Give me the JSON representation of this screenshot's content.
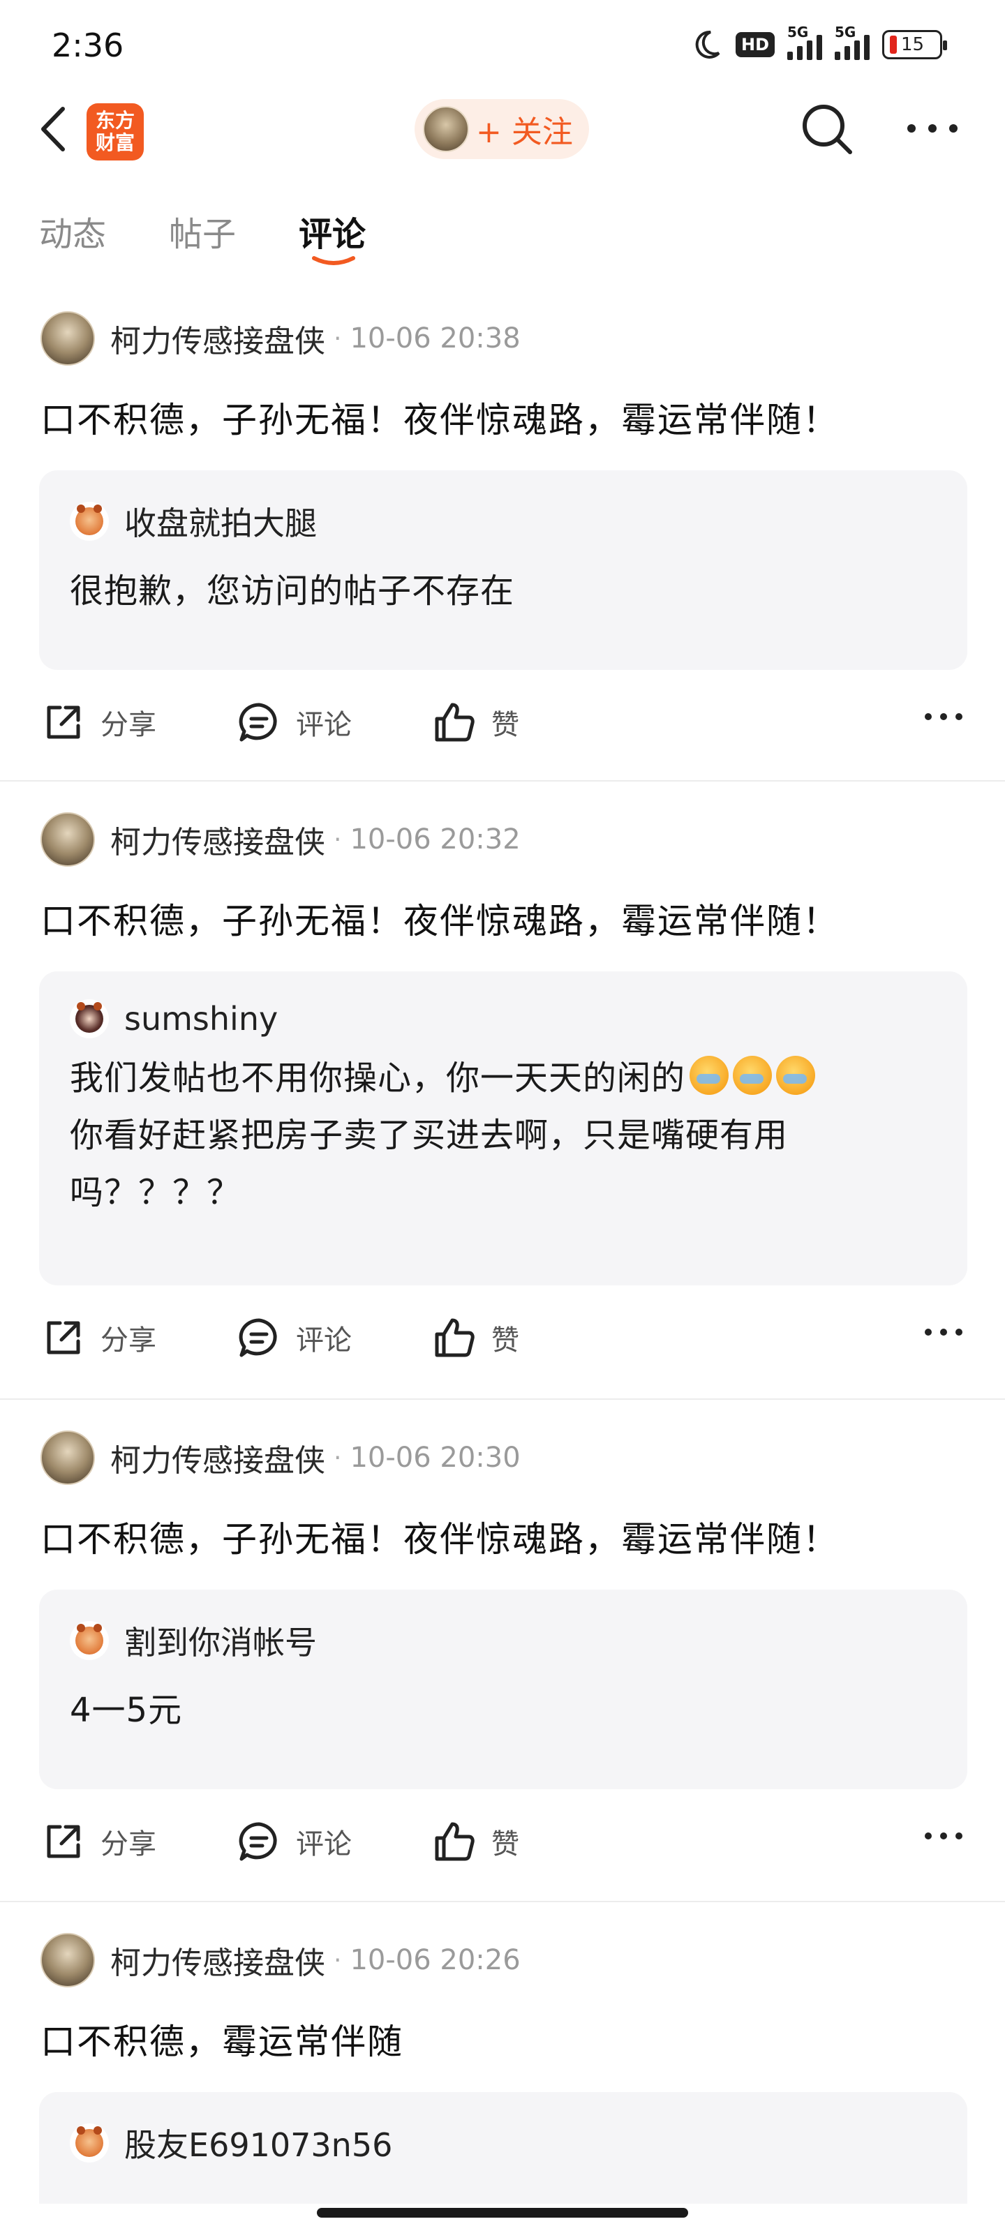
{
  "status_bar": {
    "time": "2:36",
    "hd": "HD",
    "net1": "5G",
    "net2": "5G",
    "battery": "15"
  },
  "nav": {
    "logo_line1": "东方",
    "logo_line2": "财富",
    "follow_label": "+ 关注"
  },
  "tabs": [
    {
      "label": "动态"
    },
    {
      "label": "帖子"
    },
    {
      "label": "评论"
    }
  ],
  "accent_color": "#f25a21",
  "actions": {
    "share": "分享",
    "comment": "评论",
    "like": "赞"
  },
  "posts": [
    {
      "author": "柯力传感接盘侠",
      "separator": "·",
      "time": "10-06 20:38",
      "text": "口不积德，子孙无福！夜伴惊魂路，霉运常伴随！",
      "quote_user": "收盘就拍大腿",
      "quote_line1": "很抱歉，您访问的帖子不存在"
    },
    {
      "author": "柯力传感接盘侠",
      "separator": "·",
      "time": "10-06 20:32",
      "text": "口不积德，子孙无福！夜伴惊魂路，霉运常伴随！",
      "quote_user": "sumshiny",
      "quote_line1": "我们发帖也不用你操心，你一天天的闲的",
      "quote_line2": "你看好赶紧把房子卖了买进去啊，只是嘴硬有用",
      "quote_line3": "吗？？？？"
    },
    {
      "author": "柯力传感接盘侠",
      "separator": "·",
      "time": "10-06 20:30",
      "text": "口不积德，子孙无福！夜伴惊魂路，霉运常伴随！",
      "quote_user": "割到你消帐号",
      "quote_line1": "4一5元"
    },
    {
      "author": "柯力传感接盘侠",
      "separator": "·",
      "time": "10-06 20:26",
      "text": "口不积德，霉运常伴随",
      "quote_user": "股友E691073n56"
    }
  ]
}
